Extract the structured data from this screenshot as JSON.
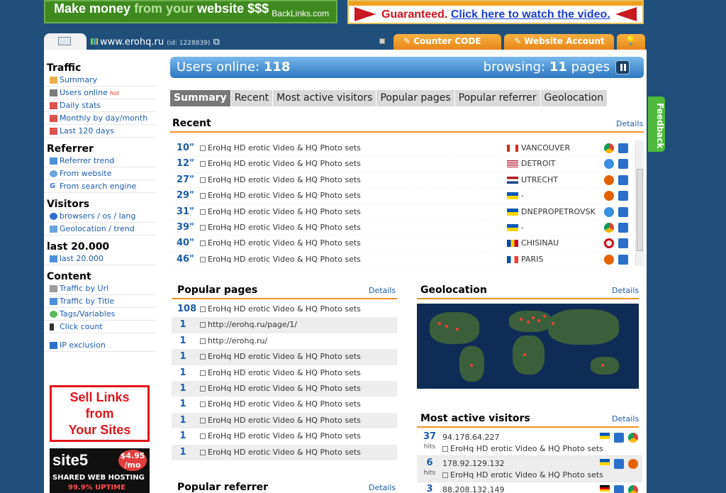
{
  "banners": {
    "left_main": "Make money",
    "left_dim": "from your",
    "left_end": "website $$$",
    "left_sub": "BackLinks.com",
    "right_text": "Guaranteed.",
    "right_link": "Click here to watch the video."
  },
  "header": {
    "site": "www.erohq.ru",
    "site_id": "(id: 1228839)",
    "tabs": [
      "Counter CODE",
      "Website Account"
    ]
  },
  "sidebar": {
    "groups": [
      {
        "title": "Traffic",
        "items": [
          "Summary",
          "Users online",
          "Daily stats",
          "Monthly by day/month",
          "Last 120 days"
        ]
      },
      {
        "title": "Referrer",
        "items": [
          "Referrer trend",
          "From website",
          "From search engine"
        ]
      },
      {
        "title": "Visitors",
        "items": [
          "browsers / os / lang",
          "Geolocation / trend"
        ]
      },
      {
        "title": "last 20.000",
        "items": [
          "last 20.000"
        ]
      },
      {
        "title": "Content",
        "items": [
          "Traffic by Url",
          "Traffic by Title",
          "Tags/Variables",
          "Click count"
        ]
      }
    ],
    "hot_badge": "hot",
    "ip_exclusion": "IP exclusion",
    "sell_links": [
      "Sell Links",
      "from",
      "Your Sites"
    ],
    "site5": {
      "logo": "site5",
      "price": "$4.95",
      "price_unit": "/mo",
      "line1": "SHARED WEB HOSTING",
      "line2": "99.9% UPTIME"
    }
  },
  "online": {
    "label": "Users online:",
    "count": "118",
    "browsing_label": "browsing:",
    "browsing_count": "11",
    "browsing_unit": "pages"
  },
  "subtabs": [
    "Summary",
    "Recent",
    "Most active visitors",
    "Popular pages",
    "Popular referrer",
    "Geolocation"
  ],
  "recent": {
    "title": "Recent",
    "details": "Details",
    "rows": [
      {
        "time": "10\"",
        "page": "EroHq HD erotic Video & HQ Photo sets",
        "city": "VANCOUVER",
        "flag": "ca"
      },
      {
        "time": "12\"",
        "page": "EroHq HD erotic Video & HQ Photo sets",
        "city": "DETROIT",
        "flag": "us"
      },
      {
        "time": "27\"",
        "page": "EroHq HD erotic Video & HQ Photo sets",
        "city": "UTRECHT",
        "flag": "nl"
      },
      {
        "time": "29\"",
        "page": "EroHq HD erotic Video & HQ Photo sets",
        "city": "-",
        "flag": "ua"
      },
      {
        "time": "31\"",
        "page": "EroHq HD erotic Video & HQ Photo sets",
        "city": "DNEPROPETROVSK",
        "flag": "ua"
      },
      {
        "time": "39\"",
        "page": "EroHq HD erotic Video & HQ Photo sets",
        "city": "-",
        "flag": "ua"
      },
      {
        "time": "40\"",
        "page": "EroHq HD erotic Video & HQ Photo sets",
        "city": "CHISINAU",
        "flag": "md"
      },
      {
        "time": "46\"",
        "page": "EroHq HD erotic Video & HQ Photo sets",
        "city": "PARIS",
        "flag": "fr"
      }
    ]
  },
  "popular_pages": {
    "title": "Popular pages",
    "details": "Details",
    "rows": [
      {
        "count": "108",
        "page": "EroHq HD erotic Video & HQ Photo sets"
      },
      {
        "count": "1",
        "page": "http://erohq.ru/page/1/"
      },
      {
        "count": "1",
        "page": "http://erohq.ru/"
      },
      {
        "count": "1",
        "page": "EroHq HD erotic Video & HQ Photo sets"
      },
      {
        "count": "1",
        "page": "EroHq HD erotic Video & HQ Photo sets"
      },
      {
        "count": "1",
        "page": "EroHq HD erotic Video & HQ Photo sets"
      },
      {
        "count": "1",
        "page": "EroHq HD erotic Video & HQ Photo sets"
      },
      {
        "count": "1",
        "page": "EroHq HD erotic Video & HQ Photo sets"
      },
      {
        "count": "1",
        "page": "EroHq HD erotic Video & HQ Photo sets"
      },
      {
        "count": "1",
        "page": "EroHq HD erotic Video & HQ Photo sets"
      }
    ]
  },
  "geolocation": {
    "title": "Geolocation",
    "details": "Details"
  },
  "most_active": {
    "title": "Most active visitors",
    "details": "Details",
    "hits_label": "hits",
    "rows": [
      {
        "hits": "37",
        "ip": "94.178.64.227",
        "page": "EroHq HD erotic Video & HQ Photo sets"
      },
      {
        "hits": "6",
        "ip": "178.92.129.132",
        "page": "EroHq HD erotic Video & HQ Photo sets"
      },
      {
        "hits": "3",
        "ip": "88.208.132.149",
        "page": ""
      }
    ]
  },
  "popular_referrer": {
    "title": "Popular referrer",
    "details": "Details"
  },
  "feedback": "Feedback",
  "colors": {
    "background": "#1f4f7a",
    "accent_orange": "#f29126",
    "link_blue": "#1d5ca8",
    "online_bar": "#2d77c0"
  }
}
